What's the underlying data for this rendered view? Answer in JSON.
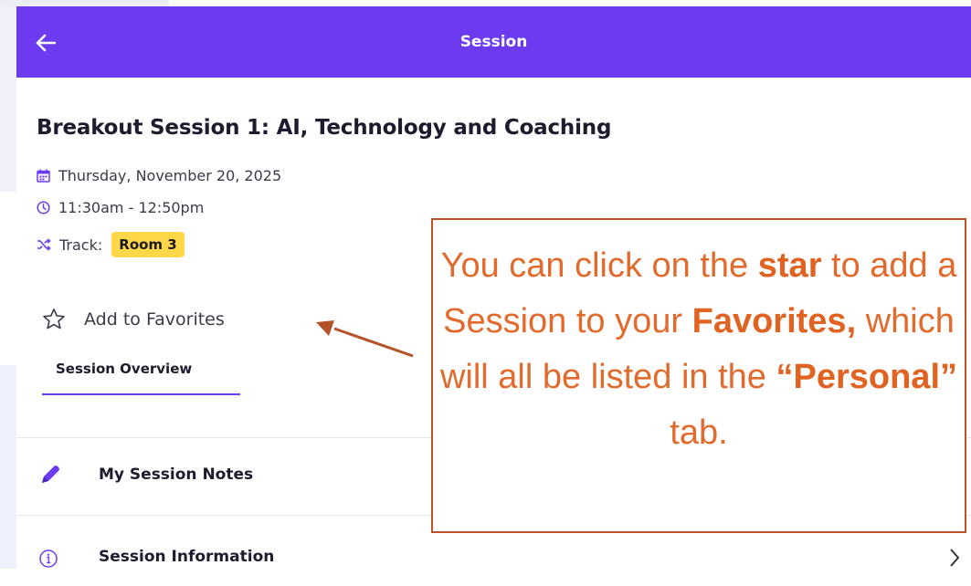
{
  "header": {
    "title": "Session"
  },
  "session": {
    "title": "Breakout Session 1: AI, Technology and Coaching",
    "date": "Thursday, November 20, 2025",
    "time": "11:30am - 12:50pm",
    "track_label": "Track:",
    "track_value": "Room 3"
  },
  "favorites": {
    "label": "Add to Favorites"
  },
  "tabs": [
    {
      "label": "Session Overview"
    }
  ],
  "menu": {
    "notes_label": "My Session Notes",
    "info_label": "Session Information"
  },
  "callout": {
    "part1": "You can click on the ",
    "part2": "star",
    "part3": " to add a Session to your ",
    "part4": "Favorites,",
    "part5": " which will all be listed in the ",
    "part6": "“Personal”",
    "part7": " tab."
  },
  "colors": {
    "accent": "#6c3bf0",
    "badge": "#ffd84a",
    "callout_text": "#e26a2c",
    "callout_border": "#c0502a"
  },
  "icons": [
    "back-arrow-icon",
    "calendar-icon",
    "clock-icon",
    "shuffle-icon",
    "star-icon",
    "pencil-icon",
    "info-icon",
    "chevron-right-icon"
  ]
}
